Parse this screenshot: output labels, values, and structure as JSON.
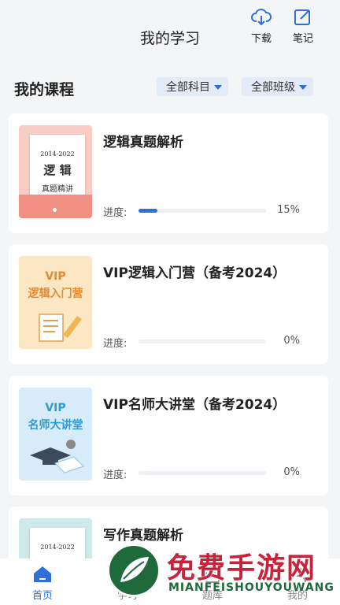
{
  "header": {
    "title": "我的学习",
    "download_label": "下载",
    "notes_label": "笔记"
  },
  "section": {
    "title": "我的课程",
    "filter_subject": "全部科目",
    "filter_class": "全部班级"
  },
  "courses": [
    {
      "title": "逻辑真题解析",
      "progress_label": "进度:",
      "progress_text": "15%",
      "progress": 0.15,
      "cover": {
        "year": "2014-2022",
        "big": "逻 辑",
        "sub": "真题精讲"
      }
    },
    {
      "title": "VIP逻辑入门营（备考2024）",
      "progress_label": "进度:",
      "progress_text": "0%",
      "progress": 0,
      "cover": {
        "line1": "VIP",
        "line2": "逻辑入门营"
      }
    },
    {
      "title": "VIP名师大讲堂（备考2024）",
      "progress_label": "进度:",
      "progress_text": "0%",
      "progress": 0,
      "cover": {
        "line1": "VIP",
        "line2": "名师大讲堂"
      }
    },
    {
      "title": "写作真题解析",
      "cover": {
        "year": "2014-2022"
      }
    }
  ],
  "nav": {
    "items": [
      {
        "label": "首页",
        "icon": "home-icon",
        "active": true
      },
      {
        "label": "学习",
        "icon": "study-icon",
        "active": false
      },
      {
        "label": "题库",
        "icon": "question-bank-icon",
        "active": false
      },
      {
        "label": "我的",
        "icon": "profile-icon",
        "active": false
      }
    ]
  },
  "watermark": {
    "line1": "免费手游网",
    "line2": "MIANFEISHOUYOUWANG"
  },
  "colors": {
    "accent": "#2f6fd8",
    "filter_bg": "#e3ebf8",
    "page_bg": "#f4f5f7"
  }
}
